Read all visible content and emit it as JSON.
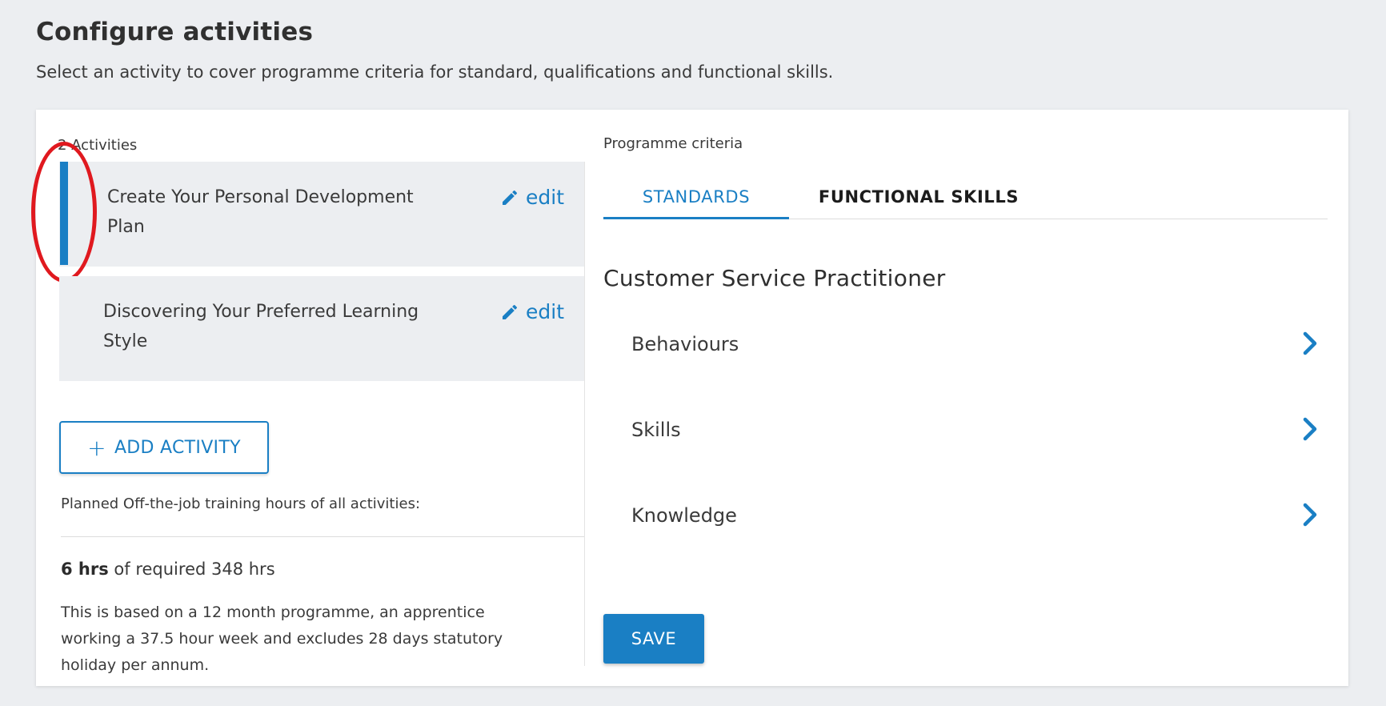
{
  "header": {
    "title": "Configure activities",
    "subtitle": "Select an activity to cover programme criteria for standard, qualifications and functional skills."
  },
  "activities": {
    "count_label": "2 Activities",
    "edit_label": "edit",
    "items": [
      {
        "label": "Create Your Personal Development Plan",
        "selected": true
      },
      {
        "label": "Discovering Your Preferred Learning Style",
        "selected": false
      }
    ],
    "add_label": "ADD ACTIVITY",
    "planned_label": "Planned Off-the-job training hours of all activities:",
    "hours_value": "6 hrs",
    "hours_rest": " of required 348 hrs",
    "note": "This is based on a 12 month programme, an apprentice working a 37.5 hour week and excludes 28 days statutory holiday per annum."
  },
  "criteria": {
    "label": "Programme criteria",
    "tabs": [
      {
        "label": "STANDARDS",
        "active": true
      },
      {
        "label": "FUNCTIONAL SKILLS",
        "active": false
      }
    ],
    "standard_name": "Customer Service Practitioner",
    "rows": [
      {
        "label": "Behaviours"
      },
      {
        "label": "Skills"
      },
      {
        "label": "Knowledge"
      }
    ],
    "save_label": "SAVE"
  },
  "colors": {
    "accent": "#1a7fc4",
    "highlight_ring": "#e0191f",
    "panel_bg": "#eceef1"
  },
  "icons": {
    "edit": "pencil-icon",
    "add": "plus-icon",
    "row_chevron": "chevron-right-icon"
  }
}
